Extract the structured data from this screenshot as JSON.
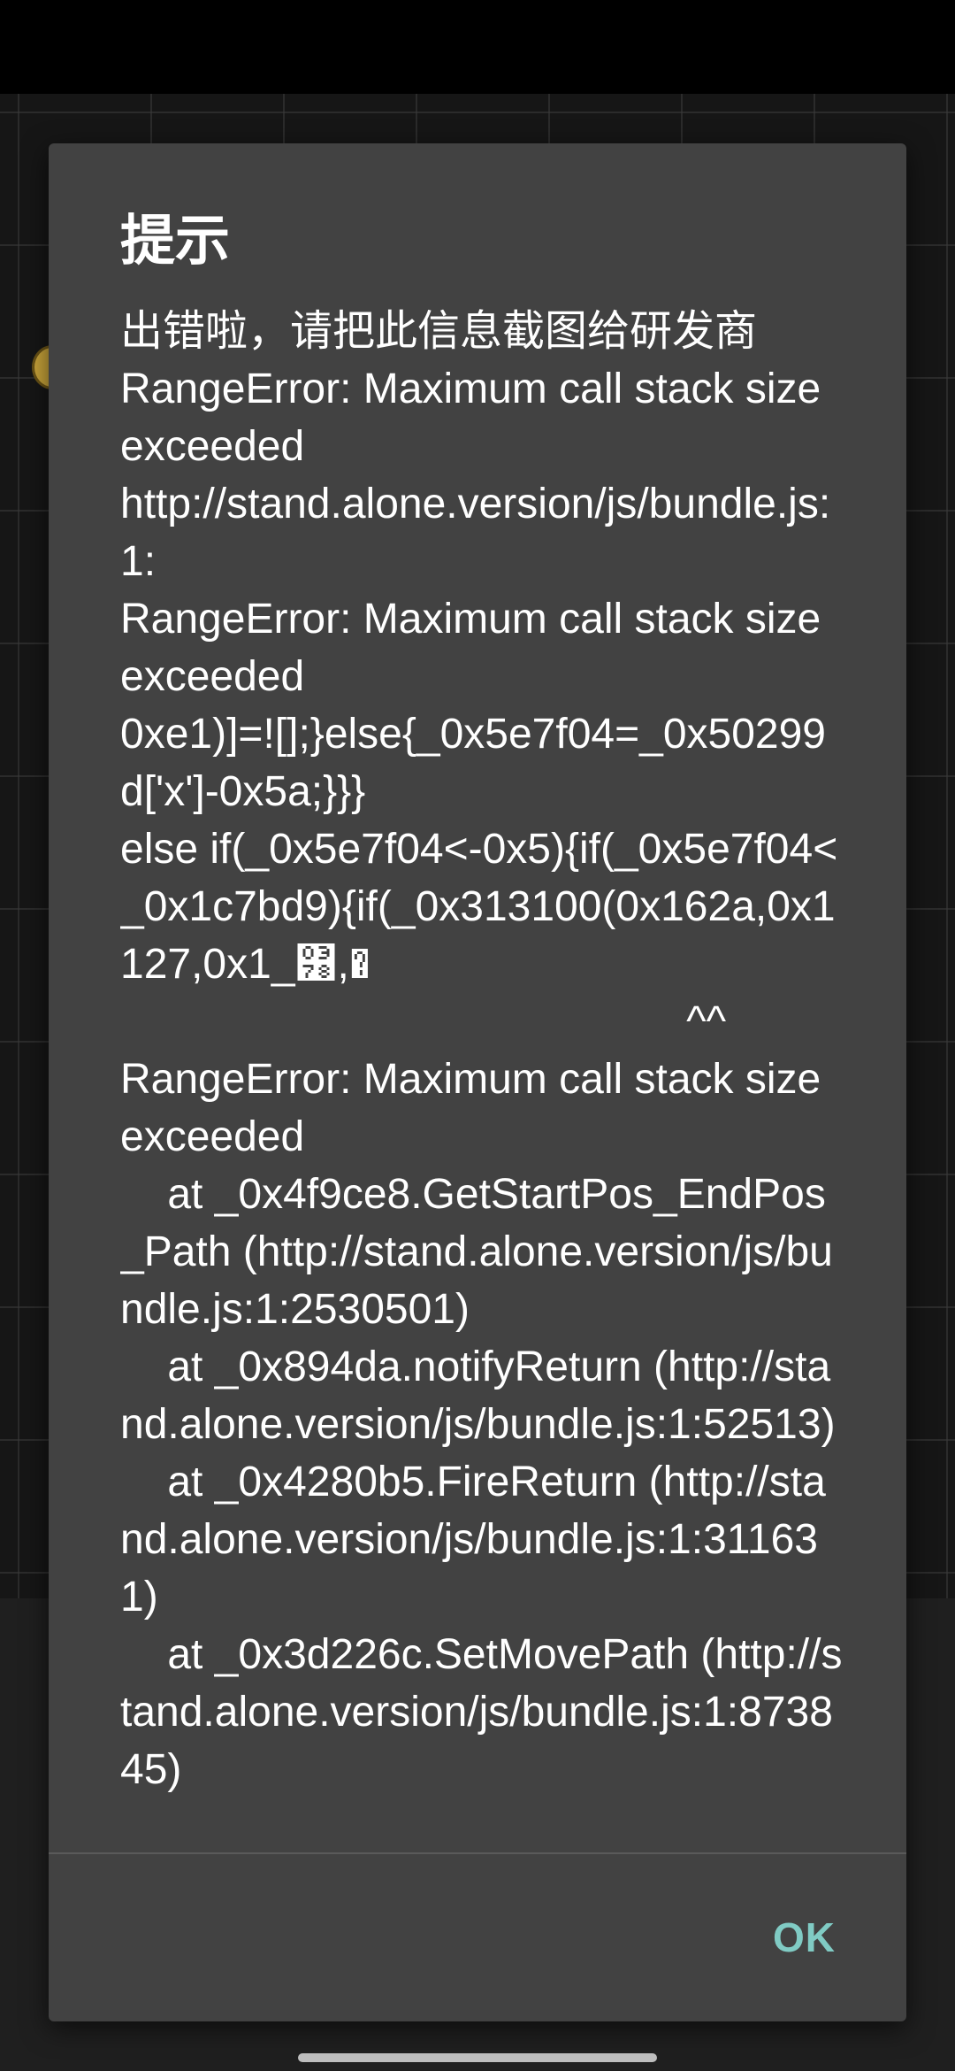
{
  "dialog": {
    "title": "提示",
    "message": "出错啦，请把此信息截图给研发商\nRangeError: Maximum call stack size exceeded\nhttp://stand.alone.version/js/bundle.js:1:\nRangeError: Maximum call stack size exceeded\n0xe1)]=![];}else{_0x5e7f04=_0x50299d['x']-0x5a;}}}\nelse if(_0x5e7f04<-0x5){if(_0x5e7f04<_0x1c7bd9){if(_0x313100(0x162a,0x1127,0x1_͸,�\n                                                ^^\nRangeError: Maximum call stack size exceeded\n    at _0x4f9ce8.GetStartPos_EndPos_Path (http://stand.alone.version/js/bundle.js:1:2530501)\n    at _0x894da.notifyReturn (http://stand.alone.version/js/bundle.js:1:52513)\n    at _0x4280b5.FireReturn (http://stand.alone.version/js/bundle.js:1:311631)\n    at _0x3d226c.SetMovePath (http://stand.alone.version/js/bundle.js:1:873845)",
    "ok_label": "OK"
  },
  "colors": {
    "dialog_background": "#424242",
    "accent": "#80cbc4",
    "text": "#ffffff"
  }
}
